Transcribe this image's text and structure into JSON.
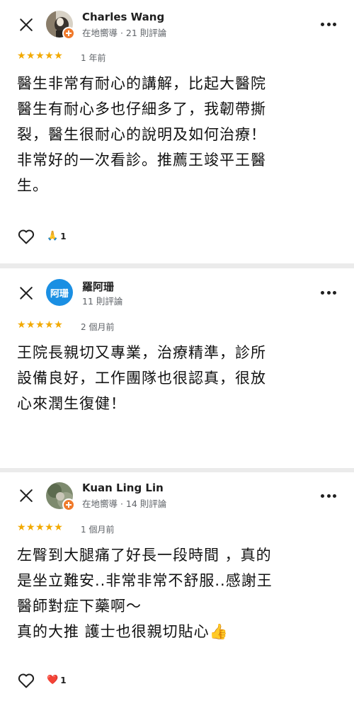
{
  "reviews": [
    {
      "reviewer": "Charles Wang",
      "meta": "在地嚮導 · 21 則評論",
      "local_guide": true,
      "stars": "★★★★★",
      "rating": 5,
      "time": "1 年前",
      "text": "醫生非常有耐心的講解，比起大醫院\n醫生有耐心多也仔細多了，我韌帶撕\n裂，醫生很耐心的說明及如何治療！\n非常好的一次看診。推薦王竣平王醫\n生。",
      "reaction_icon": "🙏",
      "reaction_count": "1"
    },
    {
      "reviewer": "羅阿珊",
      "avatar_text": "阿珊",
      "meta": "11 則評論",
      "local_guide": false,
      "stars": "★★★★★",
      "rating": 5,
      "time": "2 個月前",
      "text": "王院長親切又專業，治療精準，診所\n設備良好，工作團隊也很認真，很放\n心來潤生復健！"
    },
    {
      "reviewer": "Kuan Ling Lin",
      "meta": "在地嚮導 · 14 則評論",
      "local_guide": true,
      "stars": "★★★★★",
      "rating": 5,
      "time": "1 個月前",
      "text": "左臀到大腿痛了好長一段時間 ，真的\n是坐立難安..非常非常不舒服..感謝王\n醫師對症下藥啊～\n真的大推 護士也很親切貼心👍",
      "reaction_icon": "❤️",
      "reaction_count": "1"
    }
  ],
  "colors": {
    "star": "#f2a900",
    "avatar_blue": "#1a8fe3",
    "guide_badge": "#f07a2c",
    "divider": "#ebebeb"
  },
  "icons": [
    "close-icon",
    "more-vert-icon",
    "heart-outline-icon",
    "local-guide-badge-icon"
  ]
}
